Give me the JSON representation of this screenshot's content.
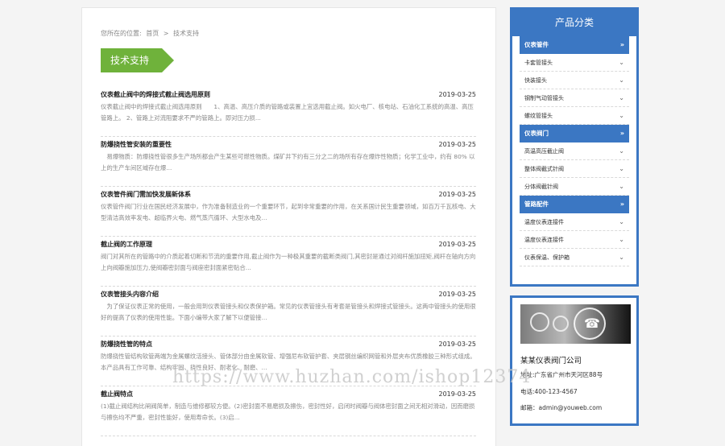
{
  "breadcrumb": {
    "prefix": "您所在的位置:",
    "home": "首页",
    "sep": ">",
    "current": "技术支持"
  },
  "section_title": "技术支持",
  "articles": [
    {
      "title": "仪表截止阀中的焊接式截止阀选用原则",
      "date": "2019-03-25",
      "excerpt": "仪表截止阀中的焊接式截止阀选用原则　　1、高温、高压介质的管路或装置上宜选用截止阀。如火电厂、核电站、石油化工系统的高温、高压管路上。 2、管路上对流阻要求不严的管路上。即对压力损..."
    },
    {
      "title": "防爆挠性管安装的重要性",
      "date": "2019-03-25",
      "excerpt": "　易爆物质：防爆挠性管很多生产场所都会产生某些可燃性物质。煤矿井下约有三分之二的场所有存在爆炸性物质；化学工业中，约有 80% 以上的生产车间区域存在爆..."
    },
    {
      "title": "仪表管件阀门需加快发展新体系",
      "date": "2019-03-25",
      "excerpt": "仪表管件阀门行业在国民经济发展中，作为准备制造业的一个重要环节，起到非常重要的作用，在关系国计民生重要领域，如百万千瓦核电、大型清洁高效率发电、超临界火电、燃气蒸汽循环、大型水电及..."
    },
    {
      "title": "截止阀的工作原理",
      "date": "2019-03-25",
      "excerpt": "阀门对其所在的管路中的介质起着切断和节流的重要作用,截止阀作为一种极其重要的截断类阀门,其密封是通过对阀杆施加扭矩,阀杆在轴向方向上向阀瓣施加压力,使阀瓣密封面与阀座密封面紧密贴合..."
    },
    {
      "title": "仪表管接头内容介绍",
      "date": "2019-03-25",
      "excerpt": "　为了保证仪表正常的使用，一般会用到仪表管接头和仪表保护箱。常见的仪表管接头有考套是管接头和焊接式管接头。这两中管接头的使用很好的提高了仪表的使用性能。下面小编带大家了解下以便管接..."
    },
    {
      "title": "防爆挠性管的特点",
      "date": "2019-03-25",
      "excerpt": "防爆挠性管结构软管两端为金属螺纹活接头、管体部分由金属软管、增强尼布软管护套、夹层钢丝编织网管和外层夹布优质橡胶三种形式组成。本产品具有工作可靠、结构牢固、挠性良好、耐老化、耐磨、..."
    },
    {
      "title": "截止阀特点",
      "date": "2019-03-25",
      "excerpt": "(1)截止阀结构比闸阀简单，制造与维修都较方便。(2)密封面不易磨损及擦伤，密封性好，启闭时阀瓣与阀体密封面之间无相对滑动，因而磨损与擦伤均不严重，密封性能好，使用寿命长。(3)启..."
    }
  ],
  "sidebar": {
    "title": "产品分类",
    "groups": [
      {
        "label": "仪表管件",
        "items": [
          "卡套管接头",
          "快装接头",
          "钢制气动管接头",
          "螺纹管接头"
        ]
      },
      {
        "label": "仪表阀门",
        "items": [
          "高温高压截止阀",
          "整体阀截式针阀",
          "分体阀截针阀"
        ]
      },
      {
        "label": "管路配件",
        "items": [
          "温度仪表连接件",
          "温度仪表连接件",
          "仪表保温、保护箱"
        ]
      }
    ]
  },
  "contact": {
    "company": "某某仪表阀门公司",
    "address": "地址:广东省广州市天河区88号",
    "phone": "电话:400-123-4567",
    "email": "邮箱：admin@youweb.com"
  },
  "watermark": "https://www.huzhan.com/ishop12374",
  "colors": {
    "accent_blue": "#3b77c3",
    "tag_green": "#6fb23b"
  }
}
